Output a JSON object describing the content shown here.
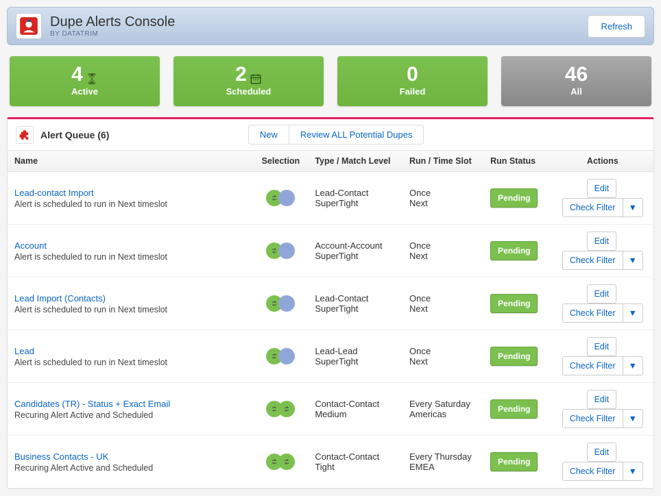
{
  "app": {
    "title": "Dupe Alerts Console",
    "vendor": "BY DATATRIM",
    "refresh_label": "Refresh"
  },
  "stats": {
    "active": {
      "value": "4",
      "label": "Active",
      "icon": "hourglass"
    },
    "scheduled": {
      "value": "2",
      "label": "Scheduled",
      "icon": "calendar"
    },
    "failed": {
      "value": "0",
      "label": "Failed",
      "icon": ""
    },
    "all": {
      "value": "46",
      "label": "All",
      "icon": ""
    }
  },
  "panel": {
    "title": "Alert Queue (6)",
    "new_label": "New",
    "review_label": "Review ALL Potential Dupes"
  },
  "columns": {
    "name": "Name",
    "selection": "Selection",
    "type": "Type / Match Level",
    "run": "Run / Time Slot",
    "status": "Run Status",
    "actions": "Actions"
  },
  "action_labels": {
    "edit": "Edit",
    "check_filter": "Check Filter",
    "dropdown_glyph": "▼"
  },
  "rows": [
    {
      "name": "Lead-contact Import",
      "sub": "Alert is scheduled to run in Next timeslot",
      "sel_variant": "green-blue-transfer",
      "type_line1": "Lead-Contact",
      "type_line2": "SuperTight",
      "run_line1": "Once",
      "run_line2": "Next",
      "status": "Pending"
    },
    {
      "name": "Account",
      "sub": "Alert is scheduled to run in Next timeslot",
      "sel_variant": "green-blue-transfer",
      "type_line1": "Account-Account",
      "type_line2": "SuperTight",
      "run_line1": "Once",
      "run_line2": "Next",
      "status": "Pending"
    },
    {
      "name": "Lead Import (Contacts)",
      "sub": "Alert is scheduled to run in Next timeslot",
      "sel_variant": "green-blue-transfer",
      "type_line1": "Lead-Contact",
      "type_line2": "SuperTight",
      "run_line1": "Once",
      "run_line2": "Next",
      "status": "Pending"
    },
    {
      "name": "Lead",
      "sub": "Alert is scheduled to run in Next timeslot",
      "sel_variant": "green-blue-transfer",
      "type_line1": "Lead-Lead",
      "type_line2": "SuperTight",
      "run_line1": "Once",
      "run_line2": "Next",
      "status": "Pending"
    },
    {
      "name": "Candidates (TR) - Status + Exact Email",
      "sub": "Recuring Alert Active and Scheduled",
      "sel_variant": "green-green-swap",
      "type_line1": "Contact-Contact",
      "type_line2": "Medium",
      "run_line1": "Every Saturday",
      "run_line2": "Americas",
      "status": "Pending"
    },
    {
      "name": "Business Contacts - UK",
      "sub": "Recuring Alert Active and Scheduled",
      "sel_variant": "green-green-swap",
      "type_line1": "Contact-Contact",
      "type_line2": "Tight",
      "run_line1": "Every Thursday",
      "run_line2": "EMEA",
      "status": "Pending"
    }
  ]
}
